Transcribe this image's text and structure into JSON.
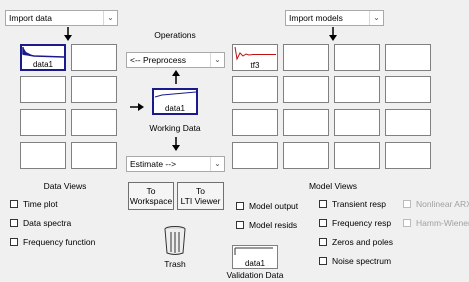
{
  "data_panel": {
    "import_data": "Import data",
    "slot1_label": "data1",
    "section_title": "Data Views",
    "views": [
      "Time plot",
      "Data spectra",
      "Frequency function"
    ]
  },
  "operations": {
    "title": "Operations",
    "preprocess": "<-- Preprocess",
    "working_label": "data1",
    "working_caption": "Working Data",
    "estimate": "Estimate -->",
    "to_workspace": "To Workspace",
    "to_workspace_l1": "To",
    "to_workspace_l2": "Workspace",
    "to_lti_l1": "To",
    "to_lti_l2": "LTI Viewer",
    "trash": "Trash",
    "validation_label": "data1",
    "validation_caption": "Validation Data"
  },
  "model_panel": {
    "import_models": "Import models",
    "slot1_label": "tf3",
    "section_title": "Model Views",
    "views_col1": [
      "Model output",
      "Model resids"
    ],
    "views_col2": [
      "Transient resp",
      "Frequency resp",
      "Zeros and poles",
      "Noise spectrum"
    ],
    "views_col3": [
      "Nonlinear ARX",
      "Hamm-Wiener"
    ]
  },
  "colors": {
    "data_blue": "#1a1a8c",
    "model_red": "#c01010"
  }
}
